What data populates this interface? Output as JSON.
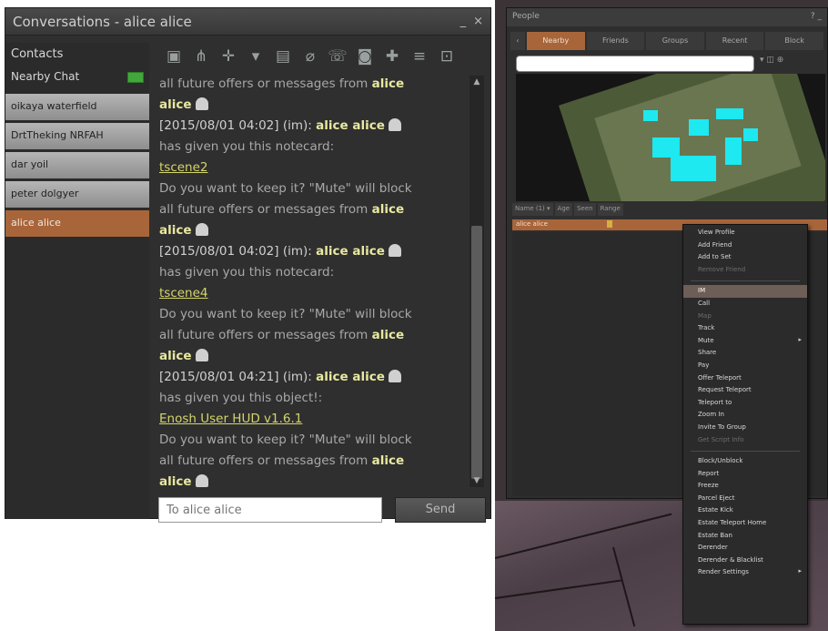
{
  "conversations": {
    "title": "Conversations - alice alice",
    "controls": {
      "minimize": "_",
      "close": "×"
    },
    "contacts_header": "Contacts",
    "contacts": [
      {
        "label": "Nearby Chat",
        "type": "nearby"
      },
      {
        "label": "oikaya waterfield",
        "type": "normal"
      },
      {
        "label": "DrtTheking NRFAH",
        "type": "normal"
      },
      {
        "label": "dar yoil",
        "type": "normal"
      },
      {
        "label": "peter dolgyer",
        "type": "normal"
      },
      {
        "label": "alice alice",
        "type": "active"
      }
    ],
    "toolbar_icons": [
      "profile-icon",
      "teleport-icon",
      "share-icon",
      "pay-icon",
      "attach-icon",
      "call-icon",
      "im-icon",
      "add-friend-icon",
      "options-icon",
      "expand-icon"
    ],
    "messages": [
      {
        "kind": "sys",
        "text": "all future offers or messages from ",
        "user": "alice"
      },
      {
        "kind": "usericon",
        "user": "alice"
      },
      {
        "kind": "ts",
        "text": "[2015/08/01 04:02] (im): ",
        "user": "alice alice"
      },
      {
        "kind": "sys",
        "text": " has given you this notecard:"
      },
      {
        "kind": "link",
        "text": "tscene2"
      },
      {
        "kind": "sys",
        "text": "Do you want to keep it? \"Mute\" will block"
      },
      {
        "kind": "sys",
        "text": "all future offers or messages from ",
        "user": "alice"
      },
      {
        "kind": "usericon",
        "user": "alice"
      },
      {
        "kind": "ts",
        "text": "[2015/08/01 04:02] (im): ",
        "user": "alice alice"
      },
      {
        "kind": "sys",
        "text": " has given you this notecard:"
      },
      {
        "kind": "link",
        "text": "tscene4"
      },
      {
        "kind": "sys",
        "text": "Do you want to keep it? \"Mute\" will block"
      },
      {
        "kind": "sys",
        "text": "all future offers or messages from ",
        "user": "alice"
      },
      {
        "kind": "usericon",
        "user": "alice"
      },
      {
        "kind": "ts",
        "text": "[2015/08/01 04:21] (im): ",
        "user": "alice alice"
      },
      {
        "kind": "sys",
        "text": " has given you this object!:"
      },
      {
        "kind": "link",
        "text": "Enosh User HUD v1.6.1"
      },
      {
        "kind": "sys",
        "text": "Do you want to keep it? \"Mute\" will block"
      },
      {
        "kind": "sys",
        "text": "all future offers or messages from ",
        "user": "alice"
      },
      {
        "kind": "usericon",
        "user": "alice"
      }
    ],
    "input_placeholder": "To alice alice",
    "send_label": "Send"
  },
  "people": {
    "title": "People",
    "controls": "? _",
    "tabs": [
      "Nearby",
      "Friends",
      "Groups",
      "Recent",
      "Block"
    ],
    "toolbar": [
      "Name (1) ▾",
      "Age",
      "Seen",
      "Range"
    ],
    "selected_row": "alice alice"
  },
  "context_menu": {
    "groups": [
      [
        {
          "label": "View Profile"
        },
        {
          "label": "Add Friend"
        },
        {
          "label": "Add to Set"
        },
        {
          "label": "Remove Friend",
          "disabled": true
        }
      ],
      [
        {
          "label": "IM",
          "highlight": true
        },
        {
          "label": "Call"
        },
        {
          "label": "Map",
          "disabled": true
        },
        {
          "label": "Track"
        },
        {
          "label": "Mute",
          "submenu": true
        },
        {
          "label": "Share"
        },
        {
          "label": "Pay"
        },
        {
          "label": "Offer Teleport"
        },
        {
          "label": "Request Teleport"
        },
        {
          "label": "Teleport to"
        },
        {
          "label": "Zoom In"
        },
        {
          "label": "Invite To Group"
        },
        {
          "label": "Get Script Info",
          "disabled": true
        }
      ],
      [
        {
          "label": "Block/Unblock"
        },
        {
          "label": "Report"
        },
        {
          "label": "Freeze"
        },
        {
          "label": "Parcel Eject"
        },
        {
          "label": "Estate Kick"
        },
        {
          "label": "Estate Teleport Home"
        },
        {
          "label": "Estate Ban"
        },
        {
          "label": "Derender"
        },
        {
          "label": "Derender & Blacklist"
        },
        {
          "label": "Render Settings",
          "submenu": true
        }
      ]
    ]
  },
  "colors": {
    "active_accent": "#a8653a",
    "link": "#d5d56b",
    "username": "#e8e8a0",
    "map_dots": "#1ee8f0"
  }
}
